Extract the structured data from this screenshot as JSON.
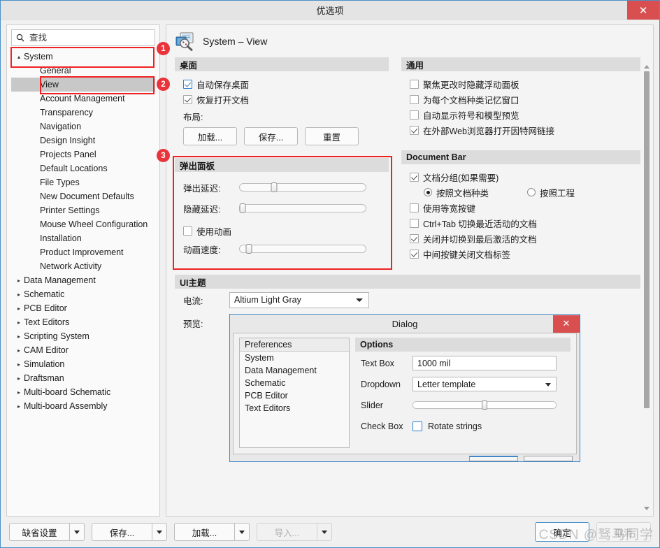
{
  "window": {
    "title": "优选项",
    "close_label": "✕"
  },
  "search": {
    "placeholder": "查找",
    "value": "",
    "icon": "search-icon"
  },
  "sidebar": {
    "items": [
      {
        "label": "System",
        "level": 0,
        "expander": "▴",
        "selected": false
      },
      {
        "label": "General",
        "level": 1,
        "expander": "",
        "selected": false
      },
      {
        "label": "View",
        "level": 1,
        "expander": "",
        "selected": true
      },
      {
        "label": "Account Management",
        "level": 1,
        "expander": "",
        "selected": false
      },
      {
        "label": "Transparency",
        "level": 1,
        "expander": "",
        "selected": false
      },
      {
        "label": "Navigation",
        "level": 1,
        "expander": "",
        "selected": false
      },
      {
        "label": "Design Insight",
        "level": 1,
        "expander": "",
        "selected": false
      },
      {
        "label": "Projects Panel",
        "level": 1,
        "expander": "",
        "selected": false
      },
      {
        "label": "Default Locations",
        "level": 1,
        "expander": "",
        "selected": false
      },
      {
        "label": "File Types",
        "level": 1,
        "expander": "",
        "selected": false
      },
      {
        "label": "New Document Defaults",
        "level": 1,
        "expander": "",
        "selected": false
      },
      {
        "label": "Printer Settings",
        "level": 1,
        "expander": "",
        "selected": false
      },
      {
        "label": "Mouse Wheel Configuration",
        "level": 1,
        "expander": "",
        "selected": false
      },
      {
        "label": "Installation",
        "level": 1,
        "expander": "",
        "selected": false
      },
      {
        "label": "Product Improvement",
        "level": 1,
        "expander": "",
        "selected": false
      },
      {
        "label": "Network Activity",
        "level": 1,
        "expander": "",
        "selected": false
      },
      {
        "label": "Data Management",
        "level": 0,
        "expander": "▸",
        "selected": false
      },
      {
        "label": "Schematic",
        "level": 0,
        "expander": "▸",
        "selected": false
      },
      {
        "label": "PCB Editor",
        "level": 0,
        "expander": "▸",
        "selected": false
      },
      {
        "label": "Text Editors",
        "level": 0,
        "expander": "▸",
        "selected": false
      },
      {
        "label": "Scripting System",
        "level": 0,
        "expander": "▸",
        "selected": false
      },
      {
        "label": "CAM Editor",
        "level": 0,
        "expander": "▸",
        "selected": false
      },
      {
        "label": "Simulation",
        "level": 0,
        "expander": "▸",
        "selected": false
      },
      {
        "label": "Draftsman",
        "level": 0,
        "expander": "▸",
        "selected": false
      },
      {
        "label": "Multi-board Schematic",
        "level": 0,
        "expander": "▸",
        "selected": false
      },
      {
        "label": "Multi-board Assembly",
        "level": 0,
        "expander": "▸",
        "selected": false
      }
    ]
  },
  "page": {
    "header_title": "System – View",
    "header_icon": "monitor-magnifier-icon"
  },
  "desktop": {
    "header": "桌面",
    "checkboxes": [
      {
        "label": "自动保存桌面",
        "checked": true,
        "focus": true
      },
      {
        "label": "恢复打开文档",
        "checked": true,
        "focus": false
      }
    ],
    "layout_label": "布局:",
    "buttons": [
      {
        "label": "加载..."
      },
      {
        "label": "保存..."
      },
      {
        "label": "重置"
      }
    ]
  },
  "popup_panels": {
    "header": "弹出面板",
    "sliders": [
      {
        "label": "弹出延迟:",
        "value": 27
      },
      {
        "label": "隐藏延迟:",
        "value": 2
      }
    ],
    "animation_checkbox": {
      "label": "使用动画",
      "checked": false
    },
    "animation_slider": {
      "label": "动画速度:",
      "value": 7
    }
  },
  "general": {
    "header": "通用",
    "checkboxes": [
      {
        "label": "聚焦更改时隐藏浮动面板",
        "checked": false
      },
      {
        "label": "为每个文档种类记忆窗口",
        "checked": false
      },
      {
        "label": "自动显示符号和模型预览",
        "checked": false
      },
      {
        "label": "在外部Web浏览器打开因特网链接",
        "checked": true
      }
    ]
  },
  "document_bar": {
    "header": "Document Bar",
    "group_checkbox": {
      "label": "文档分组(如果需要)",
      "checked": true
    },
    "radios": [
      {
        "label": "按照文档种类",
        "selected": true
      },
      {
        "label": "按照工程",
        "selected": false
      }
    ],
    "checkboxes": [
      {
        "label": "使用等宽按键",
        "checked": false
      },
      {
        "label": "Ctrl+Tab 切换最近活动的文档",
        "checked": false
      },
      {
        "label": "关闭并切换到最后激活的文档",
        "checked": true
      },
      {
        "label": "中间按键关闭文档标签",
        "checked": true
      }
    ]
  },
  "ui_theme": {
    "header": "UI主题",
    "current_label": "电流:",
    "current_value": "Altium Light Gray",
    "preview_label": "预览:",
    "preview_dialog": {
      "title": "Dialog",
      "close_label": "✕",
      "list_header": "Preferences",
      "list_items": [
        "System",
        "Data Management",
        "Schematic",
        "PCB Editor",
        "Text Editors"
      ],
      "options_header": "Options",
      "rows": [
        {
          "label": "Text Box",
          "type": "text",
          "value": "1000 mil"
        },
        {
          "label": "Dropdown",
          "type": "combo",
          "value": "Letter template"
        },
        {
          "label": "Slider",
          "type": "slider",
          "value": 50
        },
        {
          "label": "Check Box",
          "type": "checkbox",
          "value": "Rotate strings",
          "checked": false
        }
      ]
    }
  },
  "footer": {
    "split_buttons": [
      {
        "label": "缺省设置",
        "disabled": false
      },
      {
        "label": "保存...",
        "disabled": false
      },
      {
        "label": "加载...",
        "disabled": false
      },
      {
        "label": "导入...",
        "disabled": true
      }
    ],
    "ok_label": "确定",
    "cancel_label": "取消"
  },
  "annotations": {
    "badges": [
      {
        "number": "1"
      },
      {
        "number": "2"
      },
      {
        "number": "3"
      }
    ],
    "highlight_color": "#ee2222",
    "badge_color": "#e8343a"
  },
  "watermark": {
    "text": "CSDN @驽马同学"
  }
}
